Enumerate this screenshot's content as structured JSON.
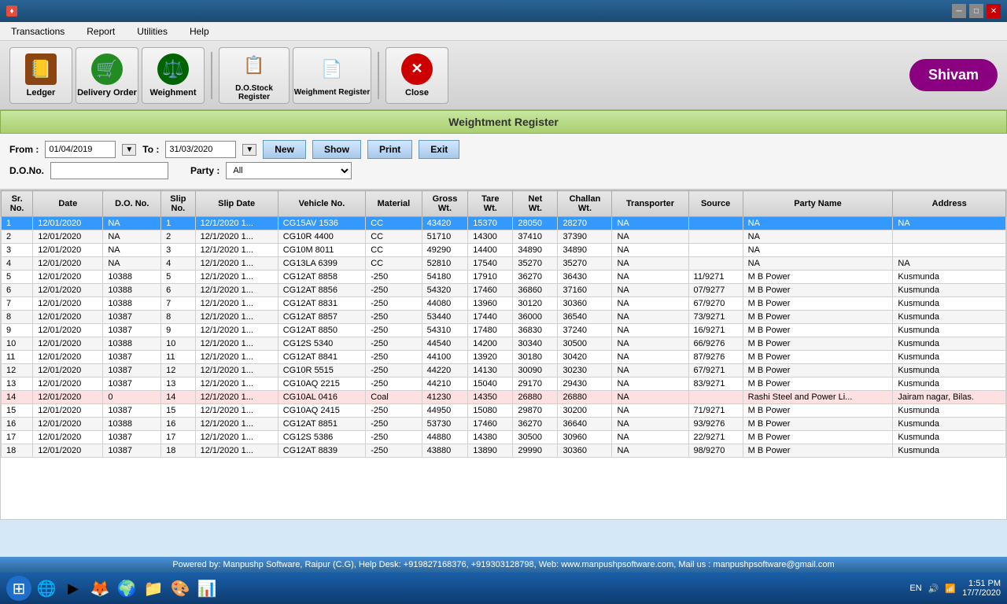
{
  "titlebar": {
    "icon": "app-icon",
    "controls": [
      "minimize",
      "maximize",
      "close"
    ]
  },
  "menubar": {
    "items": [
      "Transactions",
      "Report",
      "Utilities",
      "Help"
    ]
  },
  "toolbar": {
    "buttons": [
      {
        "id": "ledger",
        "label": "Ledger",
        "icon": "📒",
        "color": "#8B4513"
      },
      {
        "id": "delivery-order",
        "label": "Delivery Order",
        "icon": "🛒",
        "color": "#228B22"
      },
      {
        "id": "weighment",
        "label": "Weighment",
        "icon": "⚖️",
        "color": "#006400"
      },
      {
        "id": "do-stock-register",
        "label": "D.O.Stock Register",
        "icon": "📋",
        "color": "#8B6914"
      },
      {
        "id": "weighment-register",
        "label": "Weighment Register",
        "icon": "📄",
        "color": "#8B6914"
      },
      {
        "id": "close",
        "label": "Close",
        "icon": "❌",
        "color": "#cc0000"
      }
    ],
    "user": "Shivam"
  },
  "page": {
    "title": "Weightment Register"
  },
  "filter": {
    "from_label": "From :",
    "from_value": "01/04/2019",
    "to_label": "To :",
    "to_value": "31/03/2020",
    "do_no_label": "D.O.No.",
    "party_label": "Party :",
    "party_value": "All",
    "buttons": {
      "new": "New",
      "show": "Show",
      "print": "Print",
      "exit": "Exit"
    }
  },
  "table": {
    "columns": [
      "Sr. No.",
      "Date",
      "D.O. No.",
      "Slip No.",
      "Slip Date",
      "Vehicle No.",
      "Material",
      "Gross Wt.",
      "Tare Wt.",
      "Net Wt.",
      "Challan Wt.",
      "Transporter",
      "Source",
      "Party Name",
      "Address"
    ],
    "rows": [
      {
        "sr": 1,
        "date": "12/01/2020",
        "do_no": "NA",
        "slip": 1,
        "slip_date": "12/1/2020 1...",
        "vehicle": "CG15AV 1536",
        "material": "CC",
        "gross": 43420,
        "tare": 15370,
        "net": 28050,
        "challan": 28270,
        "transporter": "NA",
        "source": "",
        "party": "NA",
        "address": "NA",
        "selected": true
      },
      {
        "sr": 2,
        "date": "12/01/2020",
        "do_no": "NA",
        "slip": 2,
        "slip_date": "12/1/2020 1...",
        "vehicle": "CG10R 4400",
        "material": "CC",
        "gross": 51710,
        "tare": 14300,
        "net": 37410,
        "challan": 37390,
        "transporter": "NA",
        "source": "",
        "party": "NA",
        "address": ""
      },
      {
        "sr": 3,
        "date": "12/01/2020",
        "do_no": "NA",
        "slip": 3,
        "slip_date": "12/1/2020 1...",
        "vehicle": "CG10M 8011",
        "material": "CC",
        "gross": 49290,
        "tare": 14400,
        "net": 34890,
        "challan": 34890,
        "transporter": "NA",
        "source": "",
        "party": "NA",
        "address": ""
      },
      {
        "sr": 4,
        "date": "12/01/2020",
        "do_no": "NA",
        "slip": 4,
        "slip_date": "12/1/2020 1...",
        "vehicle": "CG13LA 6399",
        "material": "CC",
        "gross": 52810,
        "tare": 17540,
        "net": 35270,
        "challan": 35270,
        "transporter": "NA",
        "source": "",
        "party": "NA",
        "address": "NA"
      },
      {
        "sr": 5,
        "date": "12/01/2020",
        "do_no": "10388",
        "slip": 5,
        "slip_date": "12/1/2020 1...",
        "vehicle": "CG12AT 8858",
        "material": "-250",
        "gross": 54180,
        "tare": 17910,
        "net": 36270,
        "challan": 36430,
        "transporter": "NA",
        "source": "11/9271",
        "party": "M B Power",
        "address": "Kusmunda"
      },
      {
        "sr": 6,
        "date": "12/01/2020",
        "do_no": "10388",
        "slip": 6,
        "slip_date": "12/1/2020 1...",
        "vehicle": "CG12AT 8856",
        "material": "-250",
        "gross": 54320,
        "tare": 17460,
        "net": 36860,
        "challan": 37160,
        "transporter": "NA",
        "source": "07/9277",
        "party": "M B Power",
        "address": "Kusmunda"
      },
      {
        "sr": 7,
        "date": "12/01/2020",
        "do_no": "10388",
        "slip": 7,
        "slip_date": "12/1/2020 1...",
        "vehicle": "CG12AT 8831",
        "material": "-250",
        "gross": 44080,
        "tare": 13960,
        "net": 30120,
        "challan": 30360,
        "transporter": "NA",
        "source": "67/9270",
        "party": "M B Power",
        "address": "Kusmunda"
      },
      {
        "sr": 8,
        "date": "12/01/2020",
        "do_no": "10387",
        "slip": 8,
        "slip_date": "12/1/2020 1...",
        "vehicle": "CG12AT 8857",
        "material": "-250",
        "gross": 53440,
        "tare": 17440,
        "net": 36000,
        "challan": 36540,
        "transporter": "NA",
        "source": "73/9271",
        "party": "M B Power",
        "address": "Kusmunda"
      },
      {
        "sr": 9,
        "date": "12/01/2020",
        "do_no": "10387",
        "slip": 9,
        "slip_date": "12/1/2020 1...",
        "vehicle": "CG12AT 8850",
        "material": "-250",
        "gross": 54310,
        "tare": 17480,
        "net": 36830,
        "challan": 37240,
        "transporter": "NA",
        "source": "16/9271",
        "party": "M B Power",
        "address": "Kusmunda"
      },
      {
        "sr": 10,
        "date": "12/01/2020",
        "do_no": "10388",
        "slip": 10,
        "slip_date": "12/1/2020 1...",
        "vehicle": "CG12S 5340",
        "material": "-250",
        "gross": 44540,
        "tare": 14200,
        "net": 30340,
        "challan": 30500,
        "transporter": "NA",
        "source": "66/9276",
        "party": "M B Power",
        "address": "Kusmunda"
      },
      {
        "sr": 11,
        "date": "12/01/2020",
        "do_no": "10387",
        "slip": 11,
        "slip_date": "12/1/2020 1...",
        "vehicle": "CG12AT 8841",
        "material": "-250",
        "gross": 44100,
        "tare": 13920,
        "net": 30180,
        "challan": 30420,
        "transporter": "NA",
        "source": "87/9276",
        "party": "M B Power",
        "address": "Kusmunda"
      },
      {
        "sr": 12,
        "date": "12/01/2020",
        "do_no": "10387",
        "slip": 12,
        "slip_date": "12/1/2020 1...",
        "vehicle": "CG10R 5515",
        "material": "-250",
        "gross": 44220,
        "tare": 14130,
        "net": 30090,
        "challan": 30230,
        "transporter": "NA",
        "source": "67/9271",
        "party": "M B Power",
        "address": "Kusmunda"
      },
      {
        "sr": 13,
        "date": "12/01/2020",
        "do_no": "10387",
        "slip": 13,
        "slip_date": "12/1/2020 1...",
        "vehicle": "CG10AQ 2215",
        "material": "-250",
        "gross": 44210,
        "tare": 15040,
        "net": 29170,
        "challan": 29430,
        "transporter": "NA",
        "source": "83/9271",
        "party": "M B Power",
        "address": "Kusmunda"
      },
      {
        "sr": 14,
        "date": "12/01/2020",
        "do_no": "0",
        "slip": 14,
        "slip_date": "12/1/2020 1...",
        "vehicle": "CG10AL 0416",
        "material": "Coal",
        "gross": 41230,
        "tare": 14350,
        "net": 26880,
        "challan": 26880,
        "transporter": "NA",
        "source": "",
        "party": "Rashi Steel and Power Li...",
        "address": "Jairam nagar, Bilas.",
        "highlight": true
      },
      {
        "sr": 15,
        "date": "12/01/2020",
        "do_no": "10387",
        "slip": 15,
        "slip_date": "12/1/2020 1...",
        "vehicle": "CG10AQ 2415",
        "material": "-250",
        "gross": 44950,
        "tare": 15080,
        "net": 29870,
        "challan": 30200,
        "transporter": "NA",
        "source": "71/9271",
        "party": "M B Power",
        "address": "Kusmunda"
      },
      {
        "sr": 16,
        "date": "12/01/2020",
        "do_no": "10388",
        "slip": 16,
        "slip_date": "12/1/2020 1...",
        "vehicle": "CG12AT 8851",
        "material": "-250",
        "gross": 53730,
        "tare": 17460,
        "net": 36270,
        "challan": 36640,
        "transporter": "NA",
        "source": "93/9276",
        "party": "M B Power",
        "address": "Kusmunda"
      },
      {
        "sr": 17,
        "date": "12/01/2020",
        "do_no": "10387",
        "slip": 17,
        "slip_date": "12/1/2020 1...",
        "vehicle": "CG12S 5386",
        "material": "-250",
        "gross": 44880,
        "tare": 14380,
        "net": 30500,
        "challan": 30960,
        "transporter": "NA",
        "source": "22/9271",
        "party": "M B Power",
        "address": "Kusmunda"
      },
      {
        "sr": 18,
        "date": "12/01/2020",
        "do_no": "10387",
        "slip": 18,
        "slip_date": "12/1/2020 1...",
        "vehicle": "CG12AT 8839",
        "material": "-250",
        "gross": 43880,
        "tare": 13890,
        "net": 29990,
        "challan": 30360,
        "transporter": "NA",
        "source": "98/9270",
        "party": "M B Power",
        "address": "Kusmunda"
      }
    ]
  },
  "statusbar": {
    "text": "Powered by: Manpushp Software, Raipur (C.G), Help Desk: +919827168376, +919303128798, Web: www.manpushpsoftware.com,  Mail us :  manpushpsoftware@gmail.com"
  },
  "taskbar": {
    "language": "EN",
    "time": "1:51 PM",
    "date": "17/7/2020"
  }
}
